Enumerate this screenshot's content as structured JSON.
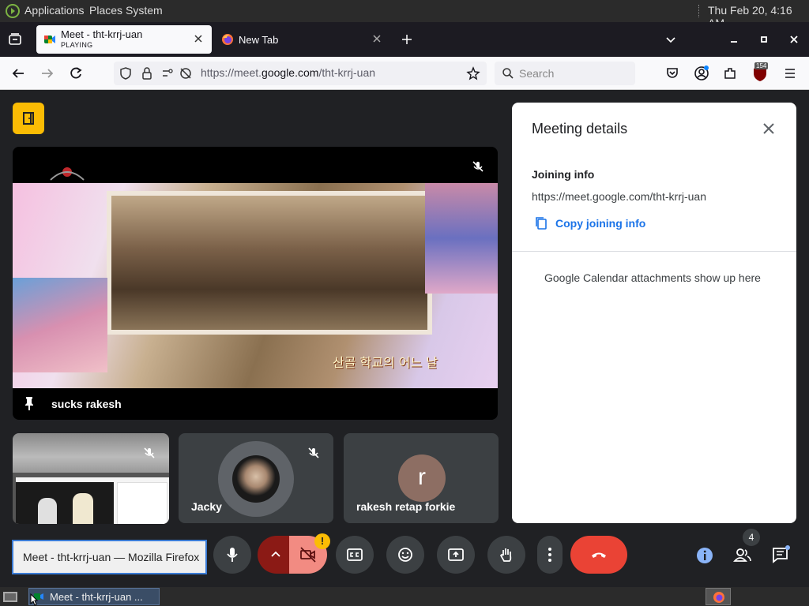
{
  "panel": {
    "menu_applications": "Applications",
    "menu_places": "Places",
    "menu_system": "System",
    "datetime": "Thu Feb 20,  4:16 AM"
  },
  "browser": {
    "tabs": [
      {
        "title": "Meet - tht-krrj-uan",
        "subtitle": "PLAYING"
      },
      {
        "title": "New Tab"
      }
    ],
    "url_prefix": "https://meet.",
    "url_domain": "google.com",
    "url_path": "/tht-krrj-uan",
    "search_placeholder": "Search",
    "extension_badge": "154"
  },
  "meet": {
    "main_speaker": "sucks rakesh",
    "video_caption": "산골 학교의 어느 날",
    "participants": [
      {
        "name": "Jacky"
      },
      {
        "name": "rakesh retap forkie",
        "initial": "r"
      }
    ],
    "participant_count": "4",
    "warning_mark": "!"
  },
  "details": {
    "title": "Meeting details",
    "joining_heading": "Joining info",
    "joining_url": "https://meet.google.com/tht-krrj-uan",
    "copy_label": "Copy joining info",
    "calendar_note": "Google Calendar attachments show up here"
  },
  "tooltip": "Meet - tht-krrj-uan — Mozilla Firefox",
  "taskbar": {
    "window_title": "Meet - tht-krrj-uan ..."
  },
  "colors": {
    "end_call": "#ea4335",
    "accent_blue": "#1a73e8",
    "meet_bg": "#202124",
    "yellow": "#fbbc04"
  }
}
